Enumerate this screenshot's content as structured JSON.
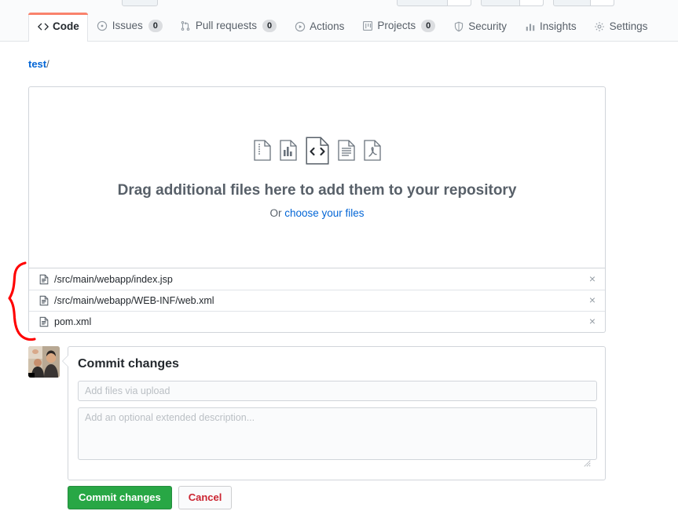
{
  "repo_nav": {
    "tabs": [
      {
        "label": "Code",
        "icon": "code-icon",
        "count": null,
        "active": true
      },
      {
        "label": "Issues",
        "icon": "issue-icon",
        "count": "0",
        "active": false
      },
      {
        "label": "Pull requests",
        "icon": "pull-request-icon",
        "count": "0",
        "active": false
      },
      {
        "label": "Actions",
        "icon": "play-icon",
        "count": null,
        "active": false
      },
      {
        "label": "Projects",
        "icon": "project-icon",
        "count": "0",
        "active": false
      },
      {
        "label": "Security",
        "icon": "shield-icon",
        "count": null,
        "active": false
      },
      {
        "label": "Insights",
        "icon": "graph-icon",
        "count": null,
        "active": false
      },
      {
        "label": "Settings",
        "icon": "gear-icon",
        "count": null,
        "active": false
      }
    ]
  },
  "breadcrumb": {
    "root": "test",
    "separator": "/"
  },
  "dropzone": {
    "title": "Drag additional files here to add them to your repository",
    "or_text": "Or ",
    "choose_link": "choose your files",
    "file_type_icons": [
      "archive-file-icon",
      "spreadsheet-file-icon",
      "code-file-icon",
      "text-file-icon",
      "pdf-file-icon"
    ]
  },
  "uploaded_files": [
    {
      "name": "/src/main/webapp/index.jsp",
      "icon": "file-icon",
      "remove_label": "×"
    },
    {
      "name": "/src/main/webapp/WEB-INF/web.xml",
      "icon": "file-icon",
      "remove_label": "×"
    },
    {
      "name": "pom.xml",
      "icon": "file-icon",
      "remove_label": "×"
    }
  ],
  "commit_form": {
    "heading": "Commit changes",
    "summary_value": "",
    "summary_placeholder": "Add files via upload",
    "description_value": "",
    "description_placeholder": "Add an optional extended description...",
    "commit_button": "Commit changes",
    "cancel_button": "Cancel"
  },
  "colors": {
    "active_tab_accent": "#f9826c",
    "link": "#0366d6",
    "commit_green": "#28a745",
    "cancel_red": "#cb2431",
    "annotation_red": "#ff0000",
    "border": "#d1d5da"
  }
}
